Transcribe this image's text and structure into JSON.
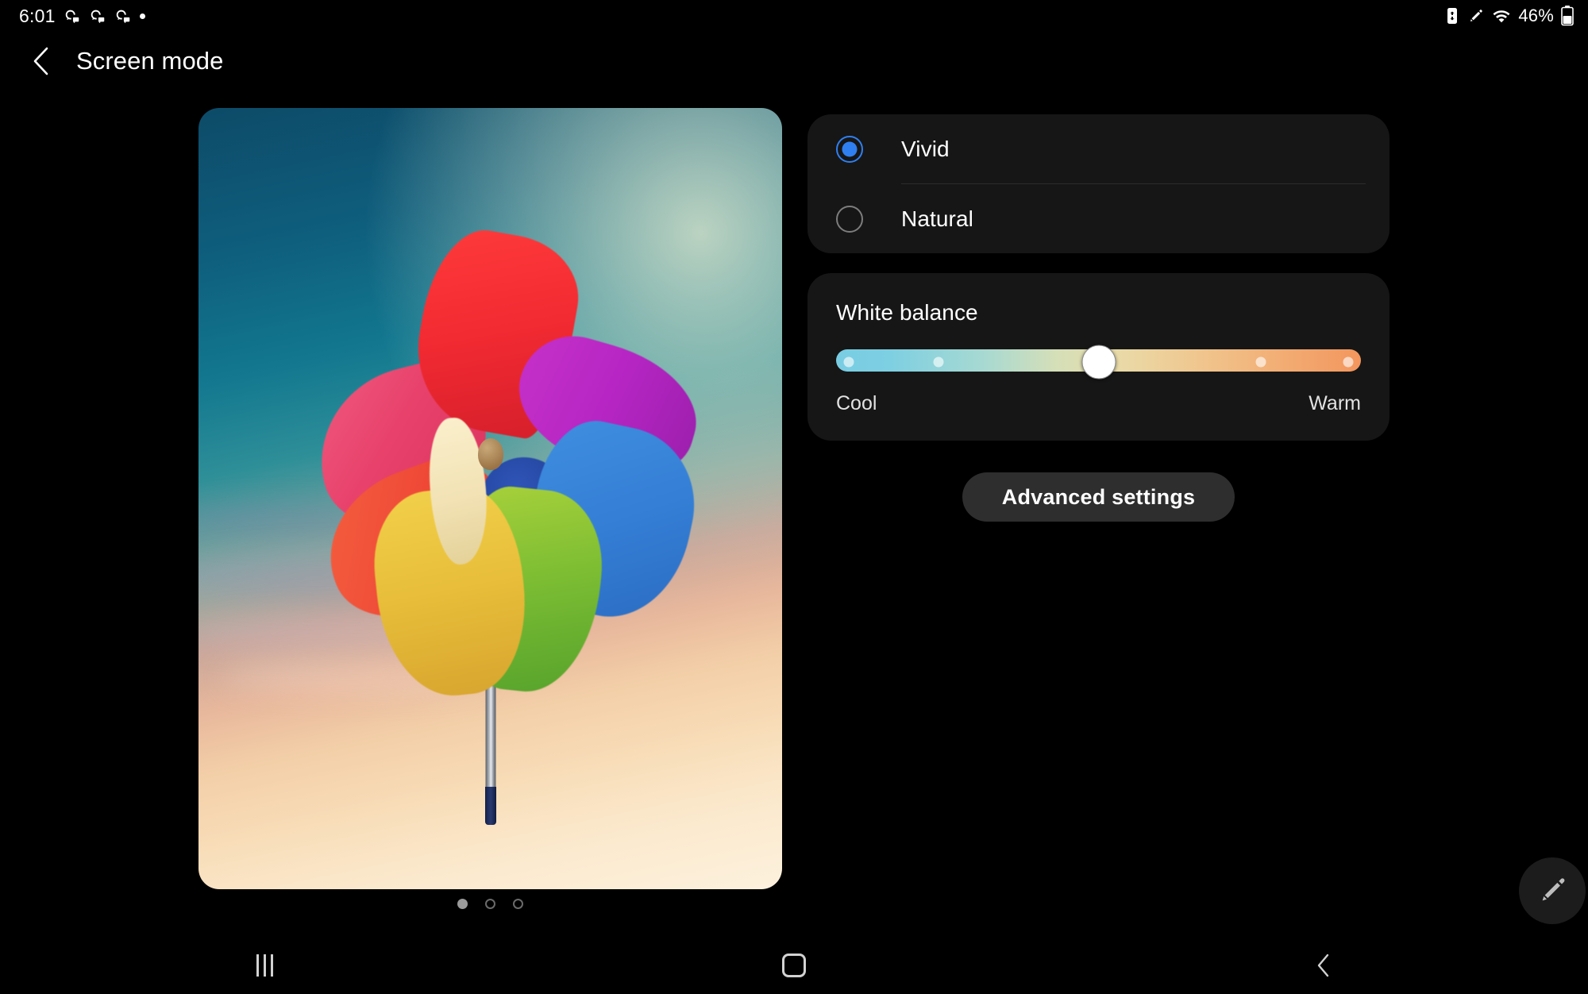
{
  "statusbar": {
    "clock": "6:01",
    "notification_icons": [
      "discord-icon",
      "discord-icon",
      "discord-icon",
      "notification-dot-icon"
    ],
    "right_icons": [
      "battery-saver-icon",
      "stylus-icon",
      "wifi-icon"
    ],
    "battery_percent": "46%",
    "battery_icon": "battery-icon"
  },
  "header": {
    "back_icon": "back-chevron-icon",
    "title": "Screen mode"
  },
  "preview": {
    "name": "screen-mode-preview-image",
    "description": "Colorful paper pinwheel against a sunset sky",
    "pager": {
      "total": 3,
      "active_index": 0
    }
  },
  "screen_mode": {
    "options": [
      {
        "label": "Vivid",
        "selected": true
      },
      {
        "label": "Natural",
        "selected": false
      }
    ]
  },
  "white_balance": {
    "title": "White balance",
    "cool_label": "Cool",
    "warm_label": "Warm",
    "value_percent": 50,
    "tick_positions": [
      2,
      18,
      50,
      82,
      98
    ],
    "gradient_start": "#79cde3",
    "gradient_end": "#f3965d"
  },
  "advanced": {
    "label": "Advanced settings"
  },
  "fab": {
    "icon": "stylus-pen-icon"
  },
  "navbar": {
    "recents_label": "recents-icon",
    "home_label": "home-icon",
    "back_label": "back-icon"
  },
  "colors": {
    "accent": "#2f7ff0",
    "card_bg": "#161616",
    "button_bg": "#2e2e2e",
    "background": "#000000"
  }
}
